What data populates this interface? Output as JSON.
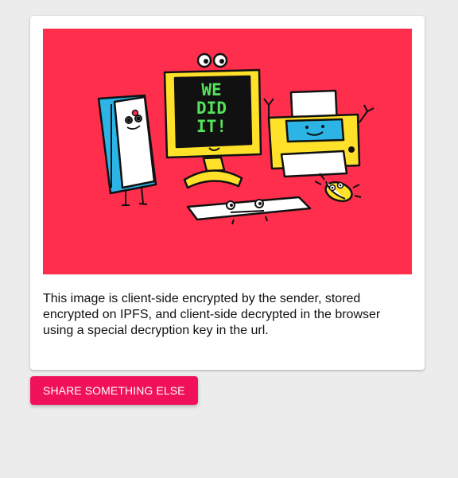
{
  "card": {
    "image": {
      "background_color": "#ff2e4d",
      "screen_text": [
        "WE",
        "DID",
        "IT!"
      ],
      "characters": [
        "fridge",
        "computer-monitor",
        "keyboard",
        "printer",
        "mouse"
      ]
    },
    "caption": "This image is client-side encrypted by the sender, stored encrypted on IPFS, and client-side decrypted in the browser using a special decryption key in the url."
  },
  "actions": {
    "share_label": "SHARE SOMETHING ELSE",
    "share_color": "#f0115a"
  }
}
